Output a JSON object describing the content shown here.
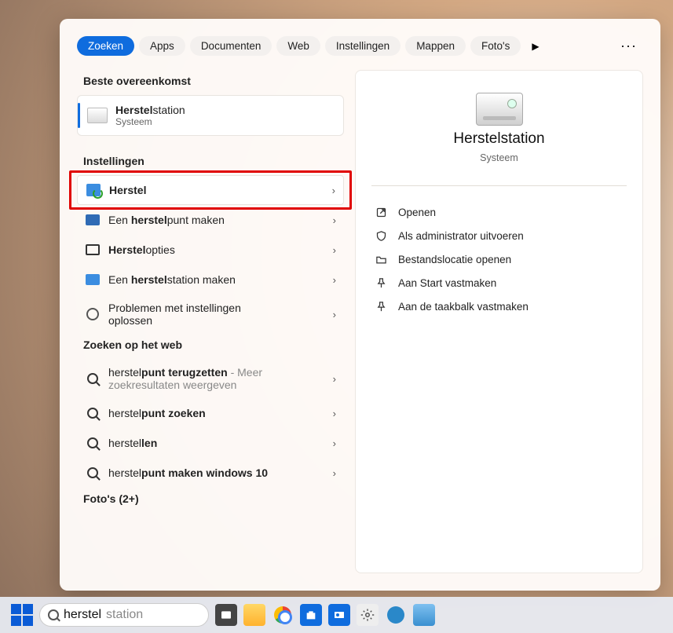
{
  "tabs": {
    "search": "Zoeken",
    "apps": "Apps",
    "documents": "Documenten",
    "web": "Web",
    "settings": "Instellingen",
    "folders": "Mappen",
    "photos": "Foto's"
  },
  "sections": {
    "best_match": "Beste overeenkomst",
    "settings": "Instellingen",
    "search_web": "Zoeken op het web",
    "photos": "Foto's (2+)"
  },
  "best": {
    "title_bold": "Herstel",
    "title_rest": "station",
    "subtitle": "Systeem"
  },
  "settings_items": {
    "herstel": {
      "plain": "",
      "bold": "Herstel",
      "rest": ""
    },
    "restorepoint": {
      "plain": "Een ",
      "bold": "herstel",
      "rest": "punt maken"
    },
    "options": {
      "plain": "",
      "bold": "Herstel",
      "rest": "opties"
    },
    "makedrive": {
      "plain": "Een ",
      "bold": "herstel",
      "rest": "station maken"
    },
    "troubleshoot": {
      "text": "Problemen met instellingen oplossen"
    }
  },
  "web_items": {
    "i1": {
      "pre": "herstel",
      "bold": "punt terugzetten",
      "muted": " - Meer zoekresultaten weergeven"
    },
    "i2": {
      "pre": "herstel",
      "bold": "punt zoeken"
    },
    "i3": {
      "pre": "herstel",
      "bold": "len"
    },
    "i4": {
      "pre": "herstel",
      "bold": "punt maken windows 10"
    }
  },
  "preview": {
    "title": "Herstelstation",
    "subtitle": "Systeem",
    "actions": {
      "open": "Openen",
      "admin": "Als administrator uitvoeren",
      "fileloc": "Bestandslocatie openen",
      "pinstart": "Aan Start vastmaken",
      "pintaskbar": "Aan de taakbalk vastmaken"
    }
  },
  "taskbar": {
    "search_typed": "herstel",
    "search_hint": "station"
  }
}
